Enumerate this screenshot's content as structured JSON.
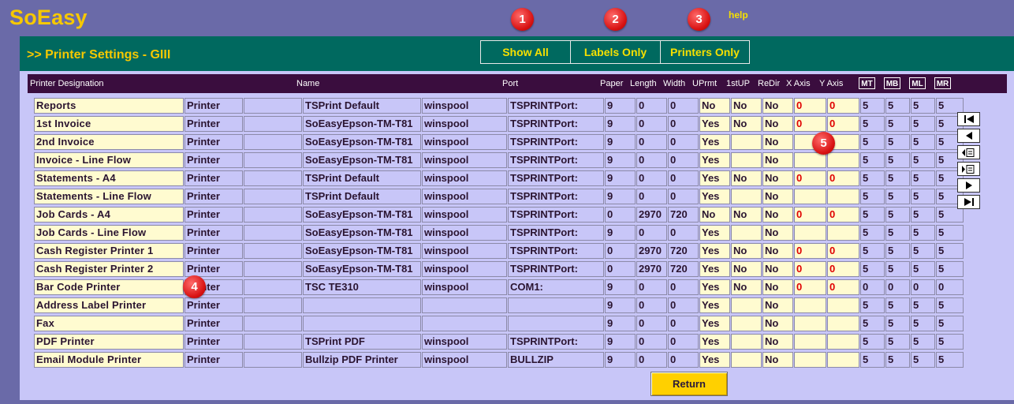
{
  "app": {
    "title": "SoEasy",
    "help": "help"
  },
  "markers": [
    "1",
    "2",
    "3",
    "4",
    "5"
  ],
  "header": {
    "heading": ">> Printer Settings - GIII",
    "filters": {
      "show_all": "Show All",
      "labels_only": "Labels Only",
      "printers_only": "Printers Only"
    }
  },
  "columns": {
    "designation": "Printer Designation",
    "name": "Name",
    "port": "Port",
    "paper": "Paper",
    "length": "Length",
    "width": "Width",
    "uprmt": "UPrmt",
    "firstup": "1stUP",
    "redir": "ReDir",
    "xaxis": "X Axis",
    "yaxis": "Y Axis",
    "mt": "MT",
    "mb": "MB",
    "ml": "ML",
    "mr": "MR"
  },
  "rows": [
    {
      "designation": "Reports",
      "type": "Printer",
      "name": "TSPrint Default",
      "driver": "winspool",
      "port": "TSPRINTPort:",
      "paper": "9",
      "length": "0",
      "width": "0",
      "uprmt": "No",
      "firstup": "No",
      "redir": "No",
      "xaxis": "0",
      "yaxis": "0",
      "mt": "5",
      "mb": "5",
      "ml": "5",
      "mr": "5"
    },
    {
      "designation": "1st Invoice",
      "type": "Printer",
      "name": "SoEasyEpson-TM-T81",
      "driver": "winspool",
      "port": "TSPRINTPort:",
      "paper": "9",
      "length": "0",
      "width": "0",
      "uprmt": "Yes",
      "firstup": "No",
      "redir": "No",
      "xaxis": "0",
      "yaxis": "0",
      "mt": "5",
      "mb": "5",
      "ml": "5",
      "mr": "5"
    },
    {
      "designation": "2nd Invoice",
      "type": "Printer",
      "name": "SoEasyEpson-TM-T81",
      "driver": "winspool",
      "port": "TSPRINTPort:",
      "paper": "9",
      "length": "0",
      "width": "0",
      "uprmt": "Yes",
      "firstup": "",
      "redir": "No",
      "xaxis": "",
      "yaxis": "",
      "mt": "5",
      "mb": "5",
      "ml": "5",
      "mr": "5"
    },
    {
      "designation": "Invoice - Line Flow",
      "type": "Printer",
      "name": "SoEasyEpson-TM-T81",
      "driver": "winspool",
      "port": "TSPRINTPort:",
      "paper": "9",
      "length": "0",
      "width": "0",
      "uprmt": "Yes",
      "firstup": "",
      "redir": "No",
      "xaxis": "",
      "yaxis": "",
      "mt": "5",
      "mb": "5",
      "ml": "5",
      "mr": "5"
    },
    {
      "designation": "Statements - A4",
      "type": "Printer",
      "name": "TSPrint Default",
      "driver": "winspool",
      "port": "TSPRINTPort:",
      "paper": "9",
      "length": "0",
      "width": "0",
      "uprmt": "Yes",
      "firstup": "No",
      "redir": "No",
      "xaxis": "0",
      "yaxis": "0",
      "mt": "5",
      "mb": "5",
      "ml": "5",
      "mr": "5"
    },
    {
      "designation": "Statements - Line Flow",
      "type": "Printer",
      "name": "TSPrint Default",
      "driver": "winspool",
      "port": "TSPRINTPort:",
      "paper": "9",
      "length": "0",
      "width": "0",
      "uprmt": "Yes",
      "firstup": "",
      "redir": "No",
      "xaxis": "",
      "yaxis": "",
      "mt": "5",
      "mb": "5",
      "ml": "5",
      "mr": "5"
    },
    {
      "designation": "Job Cards - A4",
      "type": "Printer",
      "name": "SoEasyEpson-TM-T81",
      "driver": "winspool",
      "port": "TSPRINTPort:",
      "paper": "0",
      "length": "2970",
      "width": "720",
      "uprmt": "No",
      "firstup": "No",
      "redir": "No",
      "xaxis": "0",
      "yaxis": "0",
      "mt": "5",
      "mb": "5",
      "ml": "5",
      "mr": "5"
    },
    {
      "designation": "Job Cards - Line Flow",
      "type": "Printer",
      "name": "SoEasyEpson-TM-T81",
      "driver": "winspool",
      "port": "TSPRINTPort:",
      "paper": "9",
      "length": "0",
      "width": "0",
      "uprmt": "Yes",
      "firstup": "",
      "redir": "No",
      "xaxis": "",
      "yaxis": "",
      "mt": "5",
      "mb": "5",
      "ml": "5",
      "mr": "5"
    },
    {
      "designation": "Cash Register Printer 1",
      "type": "Printer",
      "name": "SoEasyEpson-TM-T81",
      "driver": "winspool",
      "port": "TSPRINTPort:",
      "paper": "0",
      "length": "2970",
      "width": "720",
      "uprmt": "Yes",
      "firstup": "No",
      "redir": "No",
      "xaxis": "0",
      "yaxis": "0",
      "mt": "5",
      "mb": "5",
      "ml": "5",
      "mr": "5"
    },
    {
      "designation": "Cash Register Printer 2",
      "type": "Printer",
      "name": "SoEasyEpson-TM-T81",
      "driver": "winspool",
      "port": "TSPRINTPort:",
      "paper": "0",
      "length": "2970",
      "width": "720",
      "uprmt": "Yes",
      "firstup": "No",
      "redir": "No",
      "xaxis": "0",
      "yaxis": "0",
      "mt": "5",
      "mb": "5",
      "ml": "5",
      "mr": "5"
    },
    {
      "designation": "Bar Code Printer",
      "type": "Printer",
      "name": "TSC TE310",
      "driver": "winspool",
      "port": "COM1:",
      "paper": "9",
      "length": "0",
      "width": "0",
      "uprmt": "Yes",
      "firstup": "No",
      "redir": "No",
      "xaxis": "0",
      "yaxis": "0",
      "mt": "0",
      "mb": "0",
      "ml": "0",
      "mr": "0"
    },
    {
      "designation": "Address Label Printer",
      "type": "Printer",
      "name": "",
      "driver": "",
      "port": "",
      "paper": "9",
      "length": "0",
      "width": "0",
      "uprmt": "Yes",
      "firstup": "",
      "redir": "No",
      "xaxis": "",
      "yaxis": "",
      "mt": "5",
      "mb": "5",
      "ml": "5",
      "mr": "5"
    },
    {
      "designation": "Fax",
      "type": "Printer",
      "name": "",
      "driver": "",
      "port": "",
      "paper": "9",
      "length": "0",
      "width": "0",
      "uprmt": "Yes",
      "firstup": "",
      "redir": "No",
      "xaxis": "",
      "yaxis": "",
      "mt": "5",
      "mb": "5",
      "ml": "5",
      "mr": "5"
    },
    {
      "designation": "PDF Printer",
      "type": "Printer",
      "name": "TSPrint PDF",
      "driver": "winspool",
      "port": "TSPRINTPort:",
      "paper": "9",
      "length": "0",
      "width": "0",
      "uprmt": "Yes",
      "firstup": "",
      "redir": "No",
      "xaxis": "",
      "yaxis": "",
      "mt": "5",
      "mb": "5",
      "ml": "5",
      "mr": "5"
    },
    {
      "designation": "Email Module Printer",
      "type": "Printer",
      "name": "Bullzip PDF Printer",
      "driver": "winspool",
      "port": "BULLZIP",
      "paper": "9",
      "length": "0",
      "width": "0",
      "uprmt": "Yes",
      "firstup": "",
      "redir": "No",
      "xaxis": "",
      "yaxis": "",
      "mt": "5",
      "mb": "5",
      "ml": "5",
      "mr": "5"
    }
  ],
  "nav_icons": [
    "first-record-icon",
    "previous-record-icon",
    "new-record-before-icon",
    "new-record-after-icon",
    "next-record-icon",
    "last-record-icon"
  ],
  "footer": {
    "return": "Return"
  },
  "colors": {
    "background": "#6a6aa8",
    "header_teal": "#00695f",
    "accent_yellow": "#f6c800",
    "panel": "#c8c6f8",
    "column_header": "#3a0d3e",
    "field_yellow": "#fffbd0",
    "marker_red": "#d81212",
    "value_red": "#e00000"
  }
}
